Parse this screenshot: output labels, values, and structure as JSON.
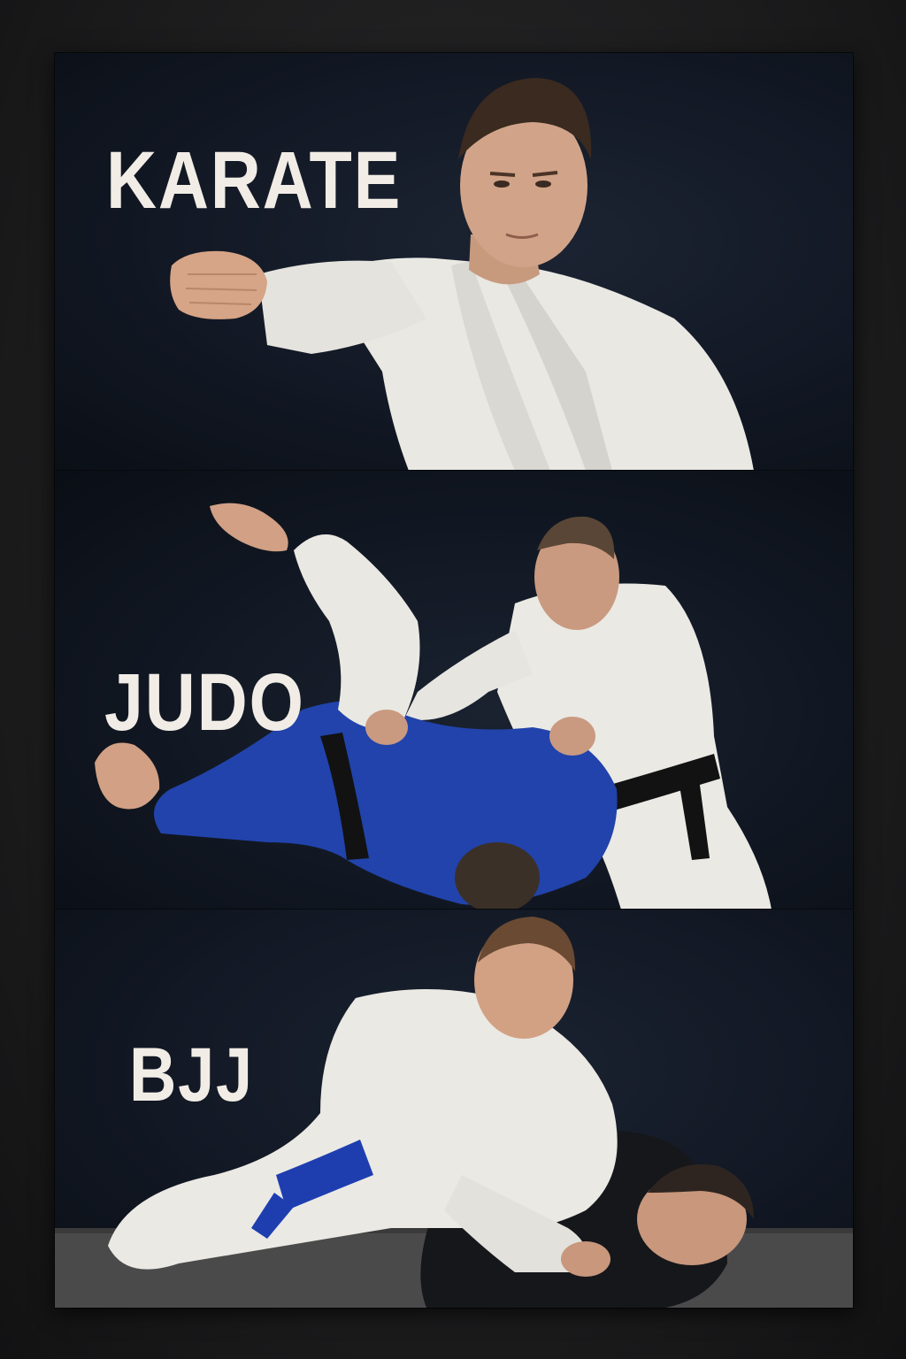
{
  "panels": [
    {
      "id": "karate",
      "label": "KARATE"
    },
    {
      "id": "judo",
      "label": "JUDO"
    },
    {
      "id": "bjj",
      "label": "BJJ"
    }
  ],
  "colors": {
    "background": "#0d1118",
    "gi_white": "#ecebe6",
    "gi_blue": "#1f3fa8",
    "gi_black": "#16171b",
    "belt_black": "#121212",
    "belt_blue": "#1e3eb0",
    "label_text": "#f1ede6"
  }
}
